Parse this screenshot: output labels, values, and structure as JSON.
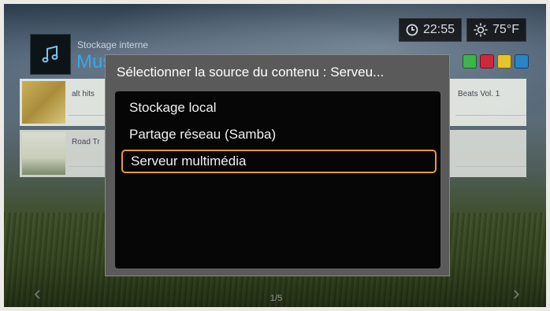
{
  "status": {
    "time": "22:55",
    "temperature": "75°F"
  },
  "header": {
    "storage_label": "Stockage interne",
    "section_title": "Musique"
  },
  "items": [
    {
      "title": "alt hits",
      "right_title": "Beats Vol. 1"
    },
    {
      "title": "Road Tr"
    }
  ],
  "dialog": {
    "title": "Sélectionner la source du contenu : Serveu...",
    "options": [
      {
        "label": "Stockage local"
      },
      {
        "label": "Partage réseau (Samba)"
      },
      {
        "label": "Serveur multimédia"
      }
    ],
    "selected_index": 2
  },
  "footer": {
    "page_indicator": "1/5"
  },
  "colors": {
    "accent": "#e39a3a",
    "title_blue": "#36a9e6",
    "green": "#3cb54a",
    "red": "#d0283a",
    "yellow": "#e5c52a",
    "blue": "#2a84c8"
  }
}
